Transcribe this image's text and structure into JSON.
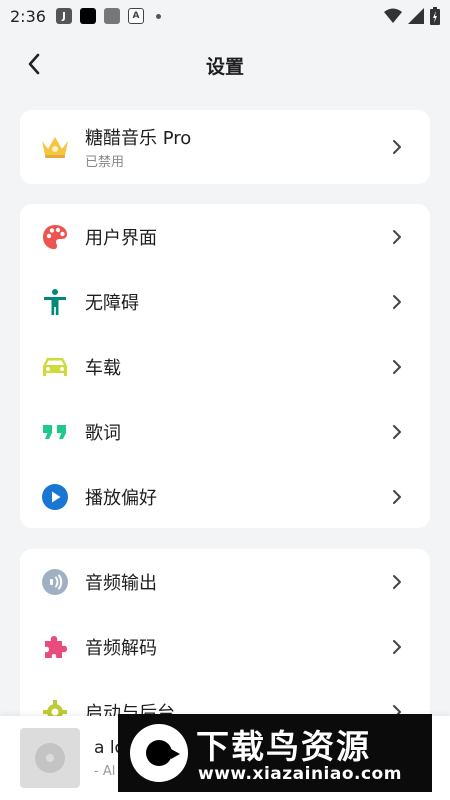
{
  "status_bar": {
    "time": "2:36",
    "app_j": "J",
    "app_a": "A"
  },
  "header": {
    "title": "设置"
  },
  "pro": {
    "title": "糖醋音乐 Pro",
    "subtitle": "已禁用"
  },
  "group1": [
    {
      "label": "用户界面",
      "icon": "palette-icon",
      "color": "#ef5350"
    },
    {
      "label": "无障碍",
      "icon": "accessibility-icon",
      "color": "#00897b"
    },
    {
      "label": "车载",
      "icon": "car-icon",
      "color": "#cddc39"
    },
    {
      "label": "歌词",
      "icon": "quote-icon",
      "color": "#1ec98a"
    },
    {
      "label": "播放偏好",
      "icon": "play-circle-icon",
      "color": "#1976d2"
    }
  ],
  "group2": [
    {
      "label": "音频输出",
      "icon": "audio-output-icon",
      "color": "#9fb0c3"
    },
    {
      "label": "音频解码",
      "icon": "puzzle-icon",
      "color": "#e94b7c"
    },
    {
      "label": "启动与后台",
      "icon": "gear-icon",
      "color": "#c0ca33"
    }
  ],
  "player": {
    "title": "a lo",
    "artist": "- Al"
  },
  "watermark": {
    "title": "下载鸟资源",
    "url": "www.xiazainiao.com"
  },
  "colors": {
    "background": "#f3f4f6",
    "card": "#ffffff",
    "crown": "#f5c542"
  }
}
